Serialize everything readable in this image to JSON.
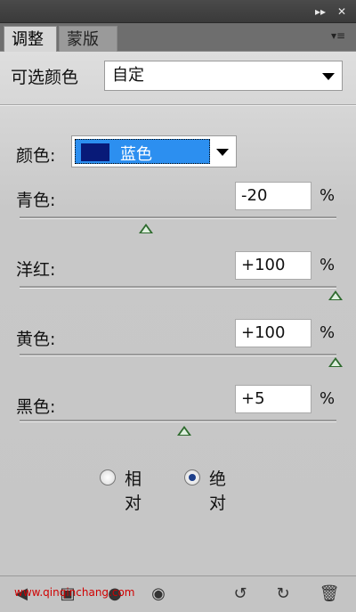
{
  "titlebar": {
    "collapse_icon": "double-chevron-right-icon",
    "close_icon": "close-icon"
  },
  "tabs": [
    {
      "label": "调整",
      "active": true
    },
    {
      "label": "蒙版",
      "active": false
    }
  ],
  "panel_menu_icon": "panel-menu-icon",
  "adjustment": {
    "name": "可选颜色",
    "preset_value": "自定"
  },
  "color_selector": {
    "label": "颜色:",
    "selected": "蓝色",
    "swatch_color": "#081a78",
    "highlight_color": "#2c8ff0"
  },
  "sliders": [
    {
      "label": "青色:",
      "value_text": "-20",
      "value": -20,
      "unit": "%"
    },
    {
      "label": "洋红:",
      "value_text": "+100",
      "value": 100,
      "unit": "%"
    },
    {
      "label": "黄色:",
      "value_text": "+100",
      "value": 100,
      "unit": "%"
    },
    {
      "label": "黑色:",
      "value_text": "+5",
      "value": 5,
      "unit": "%"
    }
  ],
  "method": {
    "options": [
      "相对",
      "绝对"
    ],
    "selected": "绝对"
  },
  "footer": {
    "watermark": "www.qinqinchang.com",
    "icons": [
      "back-arrow-icon",
      "clip-to-layer-icon",
      "layer-visibility-circle-icon",
      "eye-icon",
      "previous-state-icon",
      "reset-icon",
      "trash-icon"
    ]
  }
}
